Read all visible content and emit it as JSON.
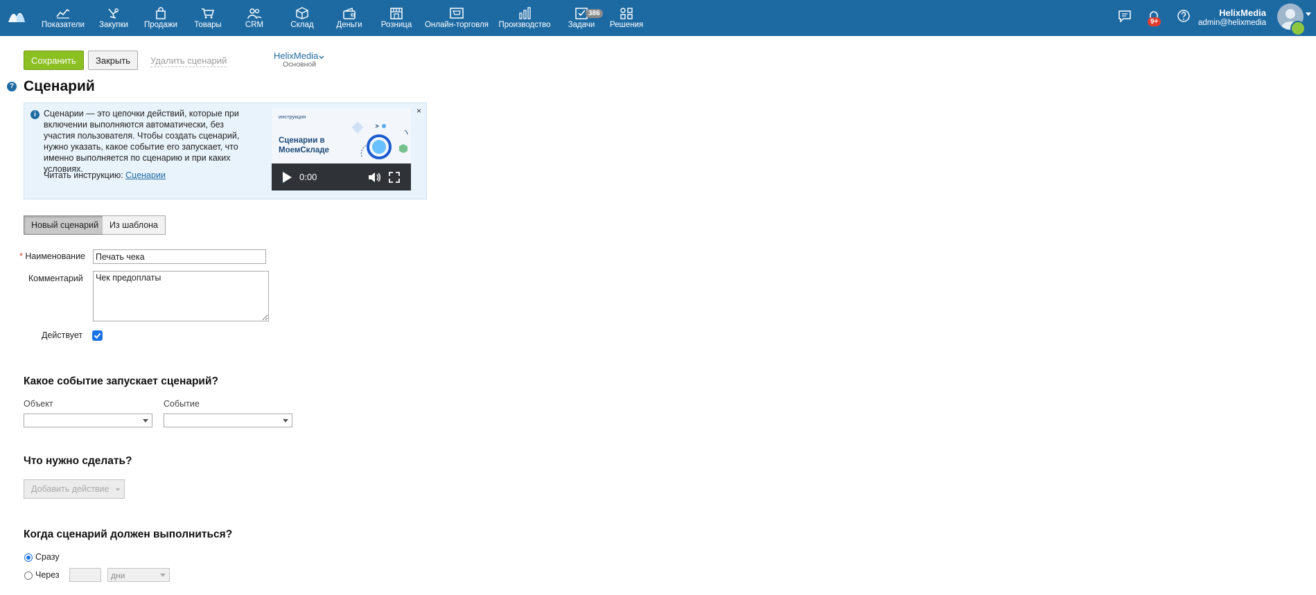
{
  "nav": {
    "items": [
      {
        "label": "Показатели"
      },
      {
        "label": "Закупки"
      },
      {
        "label": "Продажи"
      },
      {
        "label": "Товары"
      },
      {
        "label": "CRM"
      },
      {
        "label": "Склад"
      },
      {
        "label": "Деньги"
      },
      {
        "label": "Розница"
      },
      {
        "label": "Онлайн-торговля"
      },
      {
        "label": "Производство"
      },
      {
        "label": "Задачи",
        "badge": "386"
      },
      {
        "label": "Решения"
      }
    ]
  },
  "header": {
    "notifications_badge": "9+",
    "user_name": "HelixMedia",
    "user_email": "admin@helixmedia"
  },
  "toolbar": {
    "save_label": "Сохранить",
    "close_label": "Закрыть",
    "delete_label": "Удалить сценарий",
    "org_name": "HelixMedia",
    "org_sub": "Основной"
  },
  "page": {
    "title": "Сценарий",
    "help": "?"
  },
  "info": {
    "text": "Сценарии — это цепочки действий, которые при включении выполняются автоматически, без участия пользователя. Чтобы создать сценарий, нужно указать, какое событие его запускает, что именно выполняется по сценарию и при каких условиях.",
    "read_prefix": "Читать инструкцию:",
    "read_link": "Сценарии",
    "close": "×",
    "video_tag": "инструкция",
    "video_title": "Сценарии в МоемСкладе",
    "video_time": "0:00"
  },
  "tabs": {
    "new_label": "Новый сценарий",
    "template_label": "Из шаблона"
  },
  "form": {
    "name_label": "Наименование",
    "name_required": "*",
    "name_value": "Печать чека",
    "comment_label": "Комментарий",
    "comment_value": "Чек предоплаты",
    "active_label": "Действует",
    "active_checked": true
  },
  "trigger": {
    "title": "Какое событие запускает сценарий?",
    "object_label": "Объект",
    "event_label": "Событие",
    "object_value": "",
    "event_value": ""
  },
  "actions": {
    "title": "Что нужно сделать?",
    "add_label": "Добавить действие"
  },
  "timing": {
    "title": "Когда сценарий должен выполниться?",
    "now_label": "Сразу",
    "after_label": "Через",
    "after_value": "",
    "unit_value": "дни",
    "selected": "now"
  },
  "colors": {
    "topbar": "#1d6aa3",
    "save_button": "#8cbf22",
    "link": "#1d6aa3",
    "badge_red": "#e23c2e",
    "checkbox": "#1a73e8"
  }
}
